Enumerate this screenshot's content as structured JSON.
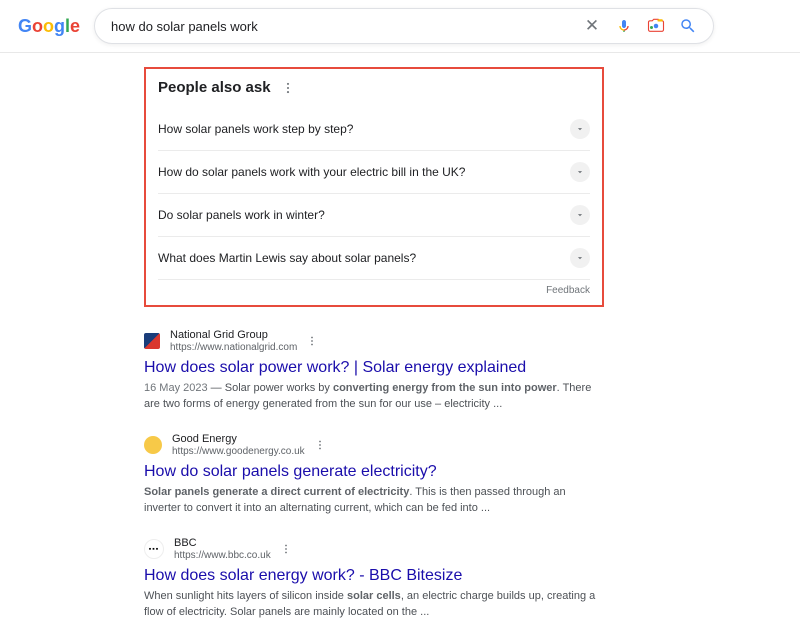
{
  "logo": {
    "g1": "G",
    "o1": "o",
    "o2": "o",
    "g2": "g",
    "l": "l",
    "e": "e"
  },
  "search": {
    "query": "how do solar panels work",
    "placeholder": ""
  },
  "paa": {
    "title": "People also ask",
    "feedback": "Feedback",
    "items": [
      {
        "q": "How solar panels work step by step?"
      },
      {
        "q": "How do solar panels work with your electric bill in the UK?"
      },
      {
        "q": "Do solar panels work in winter?"
      },
      {
        "q": "What does Martin Lewis say about solar panels?"
      }
    ]
  },
  "results": [
    {
      "source": "National Grid Group",
      "url": "https://www.nationalgrid.com",
      "title": "How does solar power work? | Solar energy explained",
      "date": "16 May 2023",
      "sep": " — ",
      "pre": "Solar power works by ",
      "bold": "converting energy from the sun into power",
      "post": ". There are two forms of energy generated from the sun for our use – electricity ...",
      "fav": "ng"
    },
    {
      "source": "Good Energy",
      "url": "https://www.goodenergy.co.uk",
      "title": "How do solar panels generate electricity?",
      "date": "",
      "sep": "",
      "pre": "",
      "bold": "Solar panels generate a direct current of electricity",
      "post": ". This is then passed through an inverter to convert it into an alternating current, which can be fed into ...",
      "fav": "ge"
    },
    {
      "source": "BBC",
      "url": "https://www.bbc.co.uk",
      "title": "How does solar energy work? - BBC Bitesize",
      "date": "",
      "sep": "",
      "pre": "When sunlight hits layers of silicon inside ",
      "bold": "solar cells",
      "post": ", an electric charge builds up, creating a flow of electricity. Solar panels are mainly located on the ...",
      "fav": "bbc",
      "bbc_text": "▪▪▪"
    }
  ]
}
